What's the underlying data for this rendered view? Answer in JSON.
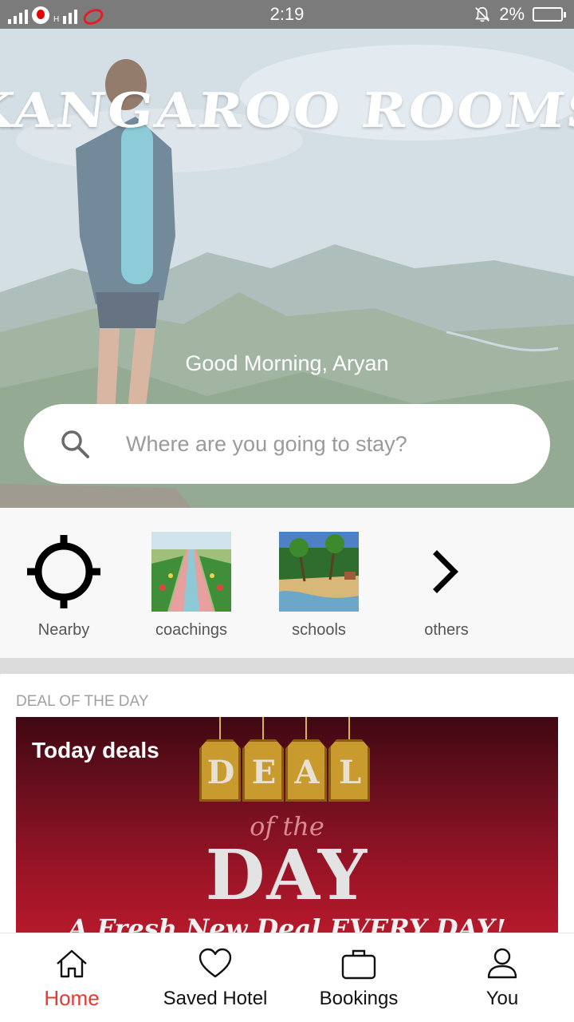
{
  "status_bar": {
    "time": "2:19",
    "battery": "2%",
    "network_small": "H"
  },
  "hero": {
    "brand": "KANGAROO ROOMS",
    "greeting": "Good Morning, Aryan",
    "search": {
      "placeholder": "Where are you going to stay?"
    }
  },
  "categories": [
    {
      "label": "Nearby",
      "icon": "crosshair-icon"
    },
    {
      "label": "coachings",
      "icon": "garden-thumbnail"
    },
    {
      "label": "schools",
      "icon": "beach-thumbnail"
    },
    {
      "label": "others",
      "icon": "chevron-right-icon"
    }
  ],
  "deal": {
    "heading": "DEAL OF THE DAY",
    "banner": {
      "title": "Today deals",
      "letters": [
        "D",
        "E",
        "A",
        "L"
      ],
      "of_the": "of the",
      "day": "DAY",
      "tagline": "A Fresh New Deal EVERY DAY!"
    }
  },
  "nav": {
    "items": [
      {
        "label": "Home",
        "icon": "home-icon",
        "active": true
      },
      {
        "label": "Saved Hotel",
        "icon": "heart-icon",
        "active": false
      },
      {
        "label": "Bookings",
        "icon": "briefcase-icon",
        "active": false
      },
      {
        "label": "You",
        "icon": "user-icon",
        "active": false
      }
    ]
  },
  "colors": {
    "accent": "#e53935",
    "status_bar": "#7b7b7b",
    "banner": "#9a1426"
  }
}
